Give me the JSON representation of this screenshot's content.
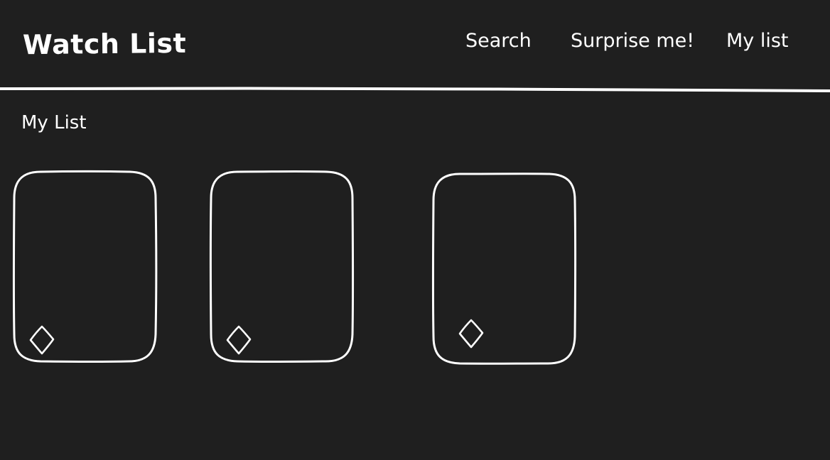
{
  "header": {
    "title": "Watch List",
    "nav": {
      "search_label": "Search",
      "surprise_label": "Surprise me!",
      "my_list_label": "My list"
    }
  },
  "main": {
    "section_title": "My List",
    "cards": [
      {
        "icon": "diamond-icon"
      },
      {
        "icon": "diamond-icon"
      },
      {
        "icon": "diamond-icon"
      }
    ]
  },
  "colors": {
    "background": "#1f1f1f",
    "foreground": "#ffffff"
  }
}
